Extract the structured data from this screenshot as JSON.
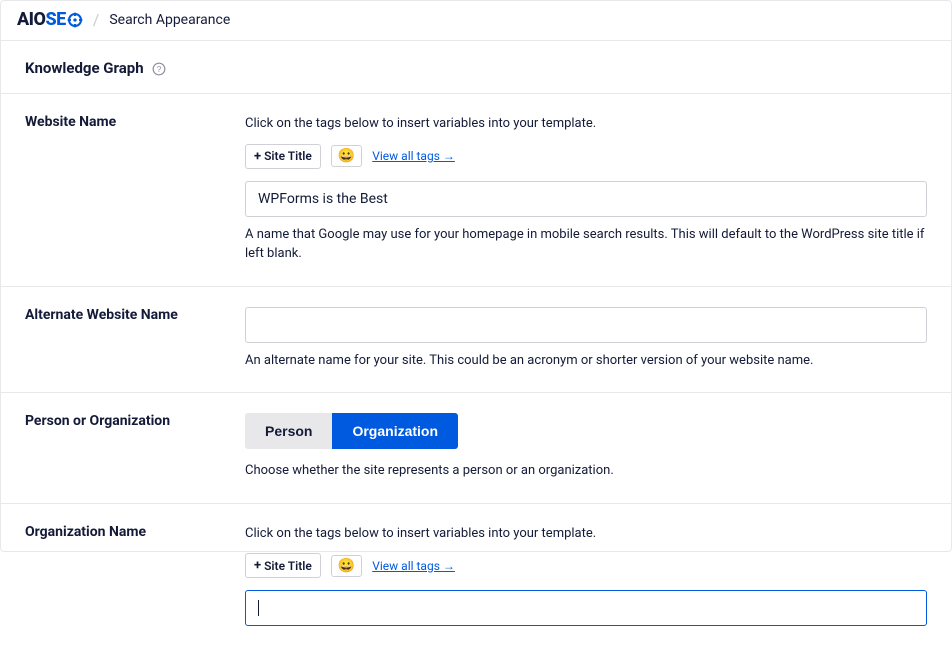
{
  "header": {
    "logo_aio": "AIO",
    "logo_se": "SE",
    "slash": "/",
    "page": "Search Appearance"
  },
  "section": {
    "title": "Knowledge Graph"
  },
  "websiteName": {
    "label": "Website Name",
    "desc": "Click on the tags below to insert variables into your template.",
    "siteTitleTag": "Site Title",
    "emoji": "😀",
    "viewAll": "View all tags →",
    "value": "WPForms is the Best",
    "help": "A name that Google may use for your homepage in mobile search results. This will default to the WordPress site title if left blank."
  },
  "altName": {
    "label": "Alternate Website Name",
    "value": "",
    "help": "An alternate name for your site. This could be an acronym or shorter version of your website name."
  },
  "personOrg": {
    "label": "Person or Organization",
    "person": "Person",
    "organization": "Organization",
    "help": "Choose whether the site represents a person or an organization."
  },
  "orgName": {
    "label": "Organization Name",
    "desc": "Click on the tags below to insert variables into your template.",
    "siteTitleTag": "Site Title",
    "emoji": "😀",
    "viewAll": "View all tags →",
    "value": ""
  }
}
